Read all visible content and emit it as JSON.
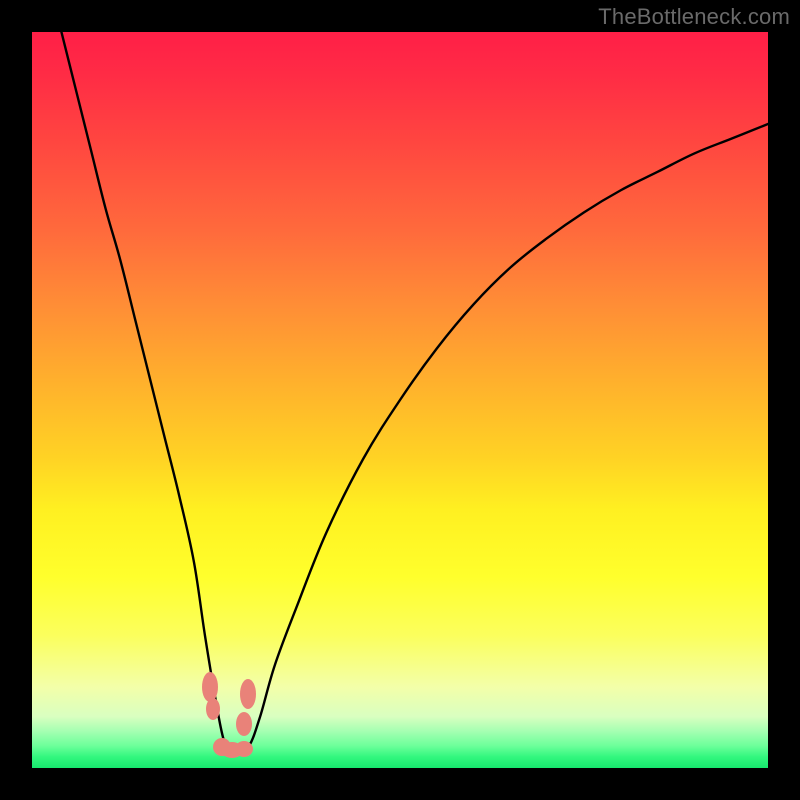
{
  "watermark": "TheBottleneck.com",
  "chart_data": {
    "type": "line",
    "title": "",
    "xlabel": "",
    "ylabel": "",
    "xlim": [
      0,
      100
    ],
    "ylim": [
      0,
      100
    ],
    "grid": false,
    "legend": false,
    "background_gradient_meaning": "vertical: red (top) = high bottleneck, green (bottom) = no bottleneck",
    "series": [
      {
        "name": "bottleneck-curve",
        "x": [
          4,
          6,
          8,
          10,
          12,
          14,
          16,
          18,
          20,
          22,
          23.5,
          25,
          26,
          27,
          28,
          29.5,
          31,
          33,
          36,
          40,
          45,
          50,
          55,
          60,
          65,
          70,
          75,
          80,
          85,
          90,
          95,
          100
        ],
        "y": [
          100,
          92,
          84,
          76,
          69,
          61,
          53,
          45,
          37,
          28,
          18,
          9,
          4,
          2,
          2,
          3,
          7,
          14,
          22,
          32,
          42,
          50,
          57,
          63,
          68,
          72,
          75.5,
          78.5,
          81,
          83.5,
          85.5,
          87.5
        ]
      }
    ],
    "optimal_range_marker": {
      "x_start": 24,
      "x_end": 30,
      "color": "#e98279",
      "meaning": "sweet spot / lowest bottleneck region"
    }
  },
  "colors": {
    "curve": "#000000",
    "marker": "#e98279",
    "watermark": "#6a6a6a",
    "frame": "#000000"
  }
}
